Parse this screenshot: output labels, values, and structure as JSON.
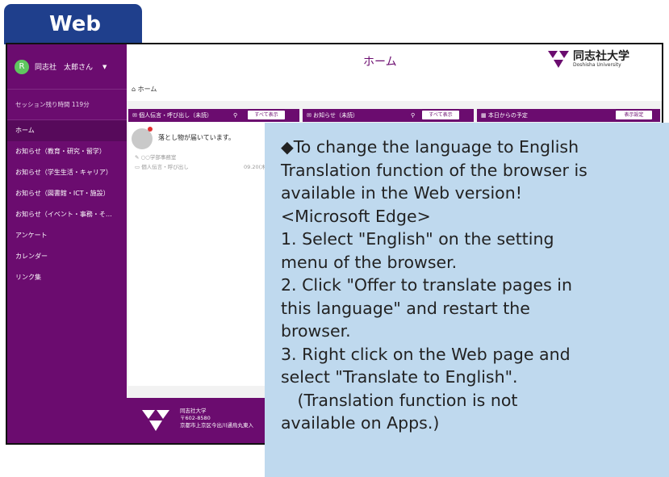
{
  "badge": {
    "label": "Web"
  },
  "sidebar": {
    "user_initial": "R",
    "user_name": "同志社　太郎さん",
    "caret": "▼",
    "session": "セッション残り時間 119分",
    "items": [
      {
        "label": "ホーム"
      },
      {
        "label": "お知らせ（教育・研究・留学）"
      },
      {
        "label": "お知らせ（学生生活・キャリア）"
      },
      {
        "label": "お知らせ（図書館・ICT・施設）"
      },
      {
        "label": "お知らせ（イベント・事務・そ…"
      },
      {
        "label": "アンケート"
      },
      {
        "label": "カレンダー"
      },
      {
        "label": "リンク集"
      }
    ]
  },
  "header": {
    "title": "ホーム",
    "logo_jp": "同志社大学",
    "logo_en": "Doshisha University",
    "breadcrumb": "⌂ ホーム"
  },
  "panels": {
    "personal": {
      "title": "✉ 個人伝言・呼び出し（未読）",
      "pin": "⚲",
      "button": "すべて表示"
    },
    "news": {
      "title": "✉ お知らせ（未読）",
      "pin": "⚲",
      "button": "すべて表示"
    },
    "schedule": {
      "title": "▦ 本日からの予定",
      "button": "表示設定"
    }
  },
  "message": {
    "title": "落とし物が届いています。",
    "sender": "✎ ○○学部事務室",
    "category": "▭ 個人伝言・呼び出し",
    "date": "09.20(木"
  },
  "footer": {
    "line1": "同志社大学",
    "line2": "〒602-8580",
    "line3": "京都市上京区今出川通烏丸東入"
  },
  "info": {
    "lines": [
      "◆To change the language to English",
      "Translation function of the browser is",
      "available in the Web version!",
      "<Microsoft Edge>",
      "1. Select \"English\" on the setting",
      "menu of the browser.",
      "2. Click \"Offer to translate pages in",
      "this language\" and restart the",
      "browser.",
      "3. Right click on the Web page and",
      "select \"Translate to English\".",
      "　(Translation function is not",
      "available on Apps.)"
    ]
  },
  "colors": {
    "brand_purple": "#6b0c6f",
    "tab_blue": "#1f3f8c",
    "info_blue": "#bfd9ee"
  }
}
